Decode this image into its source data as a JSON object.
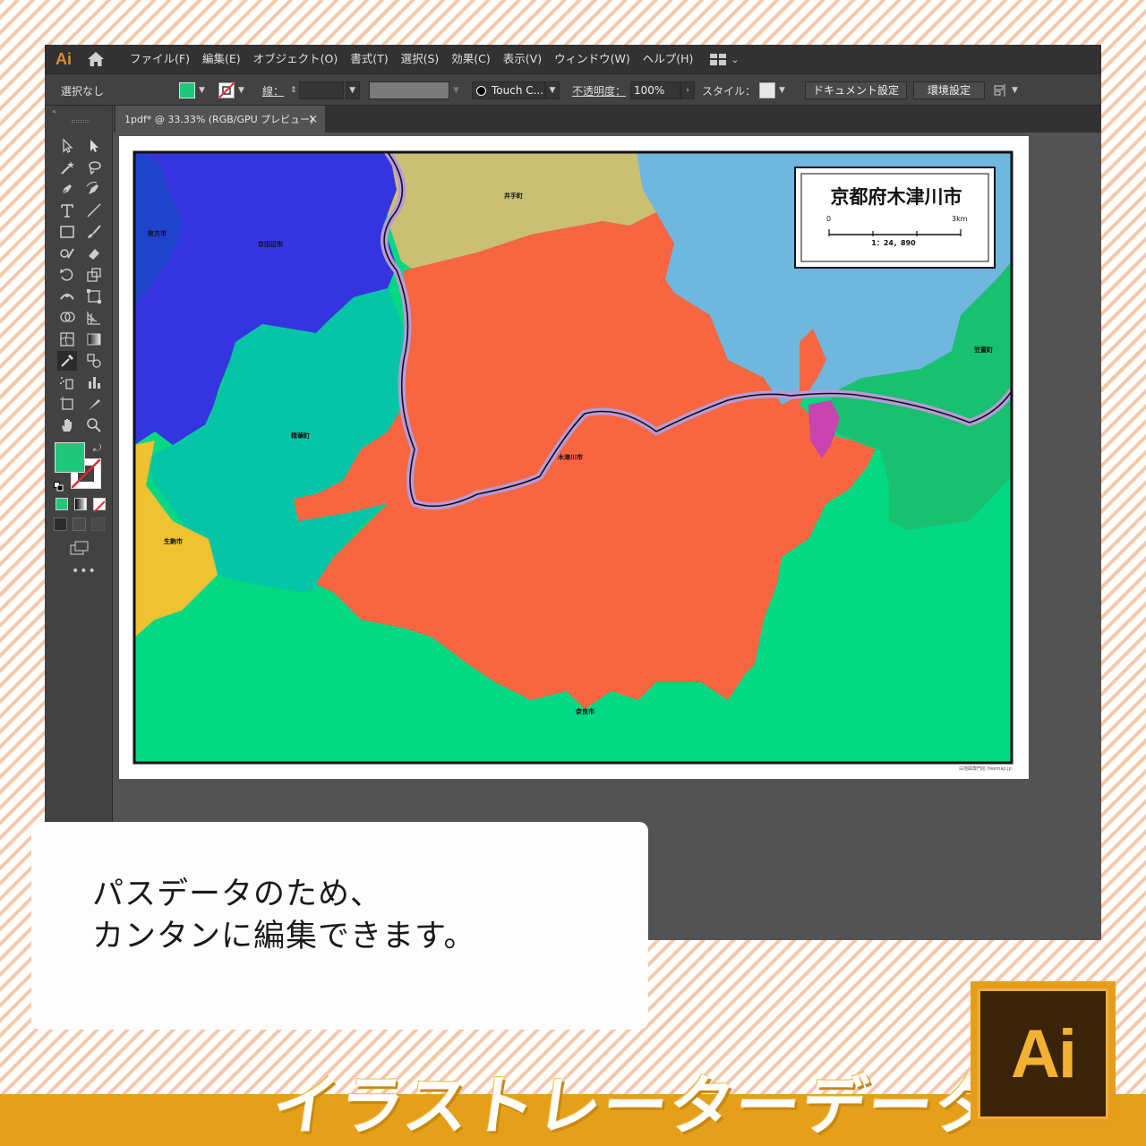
{
  "app": {
    "logo": "Ai",
    "menu": [
      "ファイル(F)",
      "編集(E)",
      "オブジェクト(O)",
      "書式(T)",
      "選択(S)",
      "効果(C)",
      "表示(V)",
      "ウィンドウ(W)",
      "ヘルプ(H)"
    ]
  },
  "control": {
    "selection": "選択なし",
    "stroke_label": "線：",
    "brush": "Touch C...",
    "opacity_label": "不透明度：",
    "opacity_value": "100%",
    "style_label": "スタイル：",
    "doc_setup": "ドキュメント設定",
    "preferences": "環境設定",
    "fill_color": "#1ec77b"
  },
  "tab": {
    "title": "1pdf* @ 33.33% (RGB/GPU プレビュー)",
    "close": "×"
  },
  "map": {
    "title": "京都府木津川市",
    "scale_start": "0",
    "scale_end": "3km",
    "scale_ratio": "1：24，890",
    "credit": "白地図専門店 freemap.jp",
    "labels": {
      "hirakata": "枚方市",
      "kyotanabe": "京田辺市",
      "ide": "井手町",
      "kasagi": "笠置町",
      "seika": "精華町",
      "kizugawa": "木津川市",
      "ikoma": "生駒市",
      "nara": "奈良市"
    },
    "colors": {
      "hirakata": "#1f44cc",
      "kyotanabe": "#3535e0",
      "ide": "#cbbf74",
      "wazuka": "#6fb7df",
      "kasagi": "#19c070",
      "seika": "#06c5a6",
      "kizugawa": "#f86641",
      "ikoma": "#eec231",
      "nara": "#03d883",
      "river": "#b89ad8"
    }
  },
  "overlay": {
    "line1": "パスデータのため、",
    "line2": "カンタンに編集できます。"
  },
  "banner": {
    "title": "イラストレーターデータ",
    "badge": "Ai",
    "color": "#e5a01b"
  }
}
